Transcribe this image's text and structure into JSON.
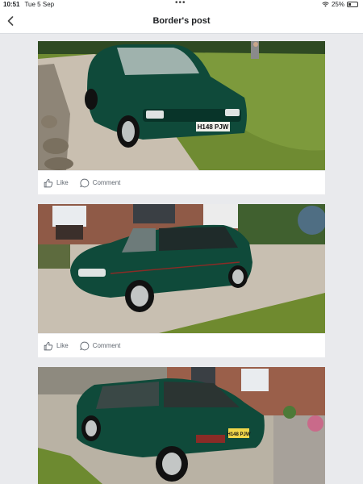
{
  "status": {
    "time": "10:51",
    "date": "Tue 5 Sep",
    "dots": "•••",
    "battery": "25%",
    "battery_level": 0.25
  },
  "nav": {
    "title": "Border's post"
  },
  "posts": [
    {
      "like_label": "Like",
      "comment_label": "Comment",
      "plate": "H148 PJW"
    },
    {
      "like_label": "Like",
      "comment_label": "Comment"
    },
    {
      "plate": "H148 PJW"
    }
  ],
  "colors": {
    "car_green": "#0f4a3a",
    "lawn": "#6d8a33",
    "brick": "#8f5a47"
  }
}
